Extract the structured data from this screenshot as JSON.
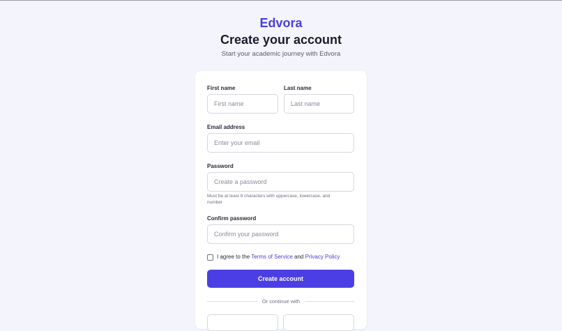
{
  "brand": "Edvora",
  "title": "Create your account",
  "subtitle": "Start your academic journey with Edvora",
  "form": {
    "first_name": {
      "label": "First name",
      "placeholder": "First name",
      "value": ""
    },
    "last_name": {
      "label": "Last name",
      "placeholder": "Last name",
      "value": ""
    },
    "email": {
      "label": "Email address",
      "placeholder": "Enter your email",
      "value": ""
    },
    "password": {
      "label": "Password",
      "placeholder": "Create a password",
      "value": "",
      "hint": "Must be at least 8 characters with uppercase, lowercase, and number"
    },
    "confirm_password": {
      "label": "Confirm password",
      "placeholder": "Confirm your password",
      "value": ""
    },
    "terms": {
      "checked": false,
      "prefix": "I agree to the ",
      "terms_link": "Terms of Service",
      "conjunction": " and ",
      "privacy_link": "Privacy Policy"
    },
    "submit_label": "Create account",
    "divider_text": "Or continue with"
  },
  "colors": {
    "accent": "#4b3fe3",
    "brand": "#4a3fd6",
    "background": "#f4f4fd"
  }
}
